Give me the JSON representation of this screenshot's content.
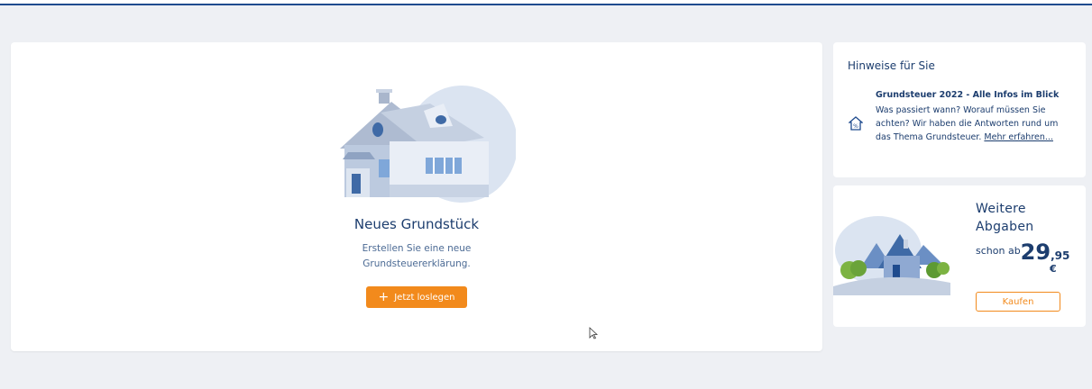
{
  "main": {
    "title": "Neues Grundstück",
    "description": "Erstellen Sie eine neue Grundsteuererklärung.",
    "start_button": "Jetzt loslegen"
  },
  "hints": {
    "heading": "Hinweise für Sie",
    "item_title": "Grundsteuer 2022 - Alle Infos im Blick",
    "item_body": "Was passiert wann? Worauf müssen Sie achten? Wir haben die Antworten rund um das Thema Grundsteuer.",
    "item_link": "Mehr erfahren..."
  },
  "promo": {
    "title": "Weitere Abgaben",
    "price_prefix": "schon ab",
    "price_whole": "29",
    "price_cents": ",95",
    "currency": "€",
    "buy_button": "Kaufen"
  },
  "colors": {
    "accent": "#f28a1c",
    "primary_text": "#1c3d6e",
    "background": "#eef0f4"
  },
  "icons": {
    "house_percent": "house-percent-icon",
    "plus": "plus-icon",
    "cursor": "mouse-pointer-icon"
  }
}
